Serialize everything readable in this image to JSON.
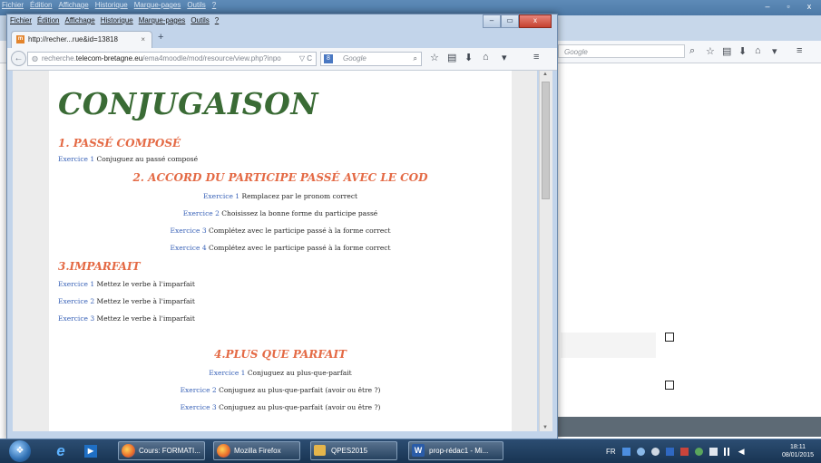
{
  "background_window": {
    "menu": [
      "Fichier",
      "Édition",
      "Affichage",
      "Historique",
      "Marque-pages",
      "Outils",
      "?"
    ],
    "controls": [
      "–",
      "▫",
      "x"
    ],
    "search_placeholder": "Google"
  },
  "window": {
    "menu": [
      "Fichier",
      "Édition",
      "Affichage",
      "Historique",
      "Marque-pages",
      "Outils",
      "?"
    ],
    "controls": {
      "minimize": "–",
      "maximize": "▭",
      "close": "x"
    },
    "tab": {
      "favicon_text": "m",
      "label": "http://recher...rue&id=13818",
      "close": "×"
    },
    "new_tab": "+",
    "url": {
      "prefix": "recherche.",
      "host": "telecom-bretagne.eu",
      "path": "/ema4moodle/mod/resource/view.php?inpo",
      "tail": "▽ C"
    },
    "search": {
      "badge": "8",
      "placeholder": "Google"
    }
  },
  "page": {
    "title": "CONJUGAISON",
    "sections": [
      {
        "heading": "1. PASSÉ COMPOSÉ",
        "items": [
          {
            "link": "Exercice 1",
            "text": "Conjuguez au passé composé"
          }
        ]
      },
      {
        "heading": "2. ACCORD DU PARTICIPE PASSÉ AVEC LE COD",
        "items": [
          {
            "link": "Exercice 1",
            "text": "Remplacez par le pronom correct"
          },
          {
            "link": "Exercice 2",
            "text": "Choisissez la bonne forme du participe passé"
          },
          {
            "link": "Exercice 3",
            "text": "Complétez avec le participe passé à la forme correct"
          },
          {
            "link": "Exercice 4",
            "text": "Complétez avec le participe passé à la forme correct"
          }
        ]
      },
      {
        "heading": "3.IMPARFAIT",
        "items": [
          {
            "link": "Exercice 1",
            "text": "Mettez le verbe à l'imparfait"
          },
          {
            "link": "Exercice 2",
            "text": "Mettez le verbe à l'imparfait"
          },
          {
            "link": "Exercice 3",
            "text": "Mettez le verbe à l'imparfait"
          }
        ]
      },
      {
        "heading": "4.PLUS QUE PARFAIT",
        "items": [
          {
            "link": "Exercice 1",
            "text": "Conjuguez au plus-que-parfait"
          },
          {
            "link": "Exercice 2",
            "text": "Conjuguez au plus-que-parfait (avoir ou être ?)"
          },
          {
            "link": "Exercice 3",
            "text": "Conjuguez au plus-que-parfait (avoir ou être ?)"
          }
        ]
      }
    ]
  },
  "taskbar": {
    "buttons": [
      {
        "label": "Cours: FORMATI..."
      },
      {
        "label": "Mozilla Firefox"
      },
      {
        "label": "QPES2015"
      },
      {
        "label": "prop-rédac1 - Mi..."
      }
    ],
    "language": "FR",
    "time": "18:11",
    "date": "08/01/2015"
  },
  "colors": {
    "title_green": "#3a6b35",
    "heading_orange": "#e46a45",
    "link_blue": "#3a63b8"
  }
}
